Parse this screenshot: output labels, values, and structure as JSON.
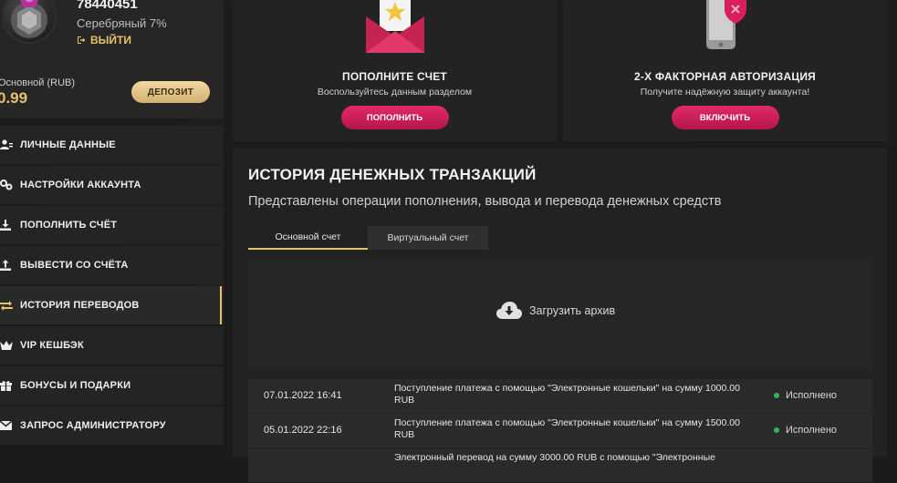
{
  "profile": {
    "user_id": "78440451",
    "level": "Серебряный 7%",
    "logout_label": "ВЫЙТИ",
    "balance_label": "Основной (RUB)",
    "balance_value": "0.99",
    "deposit_button": "ДЕПОЗИТ"
  },
  "menu": {
    "items": [
      {
        "label": "ЛИЧНЫЕ ДАННЫЕ",
        "icon": "user-icon"
      },
      {
        "label": "НАСТРОЙКИ АККАУНТА",
        "icon": "settings-icon"
      },
      {
        "label": "ПОПОЛНИТЬ СЧЁТ",
        "icon": "download-icon"
      },
      {
        "label": "ВЫВЕСТИ СО СЧЁТА",
        "icon": "upload-icon"
      },
      {
        "label": "ИСТОРИЯ ПЕРЕВОДОВ",
        "icon": "transfer-icon",
        "active": true
      },
      {
        "label": "VIP КЕШБЭК",
        "icon": "crown-icon"
      },
      {
        "label": "БОНУСЫ И ПОДАРКИ",
        "icon": "gift-icon"
      },
      {
        "label": "ЗАПРОС АДМИНИСТРАТОРУ",
        "icon": "mail-icon"
      }
    ]
  },
  "cards": {
    "deposit": {
      "title": "ПОПОЛНИТЕ СЧЕТ",
      "subtitle": "Воспользуйтесь данным разделом",
      "button": "ПОПОЛНИТЬ",
      "icon": "envelope-star-icon"
    },
    "twofa": {
      "title": "2-Х ФАКТОРНАЯ АВТОРИЗАЦИЯ",
      "subtitle": "Получите надёжную защиту аккаунта!",
      "button": "ВКЛЮЧИТЬ",
      "icon": "phone-shield-icon"
    }
  },
  "history": {
    "title": "ИСТОРИЯ ДЕНЕЖНЫХ ТРАНЗАКЦИЙ",
    "subtitle": "Представлены операции пополнения, вывода и перевода денежных средств",
    "tabs": [
      "Основной счет",
      "Виртуальный счет"
    ],
    "active_tab": 0,
    "archive_label": "Загрузить архив",
    "transactions": [
      {
        "date": "07.01.2022 16:41",
        "description": "Поступление платежа с помощью \"Электронные кошельки\" на сумму 1000.00 RUB",
        "status": "Исполнено"
      },
      {
        "date": "05.01.2022 22:16",
        "description": "Поступление платежа с помощью \"Электронные кошельки\" на сумму 1500.00 RUB",
        "status": "Исполнено"
      },
      {
        "date": "",
        "description": "Электронный перевод на сумму 3000.00 RUB с помощью \"Электронные",
        "status": ""
      }
    ]
  },
  "colors": {
    "accent_gold": "#e6c36a",
    "accent_pink": "#d81f5b",
    "status_green": "#2fb556",
    "background": "#1b1b1b"
  }
}
